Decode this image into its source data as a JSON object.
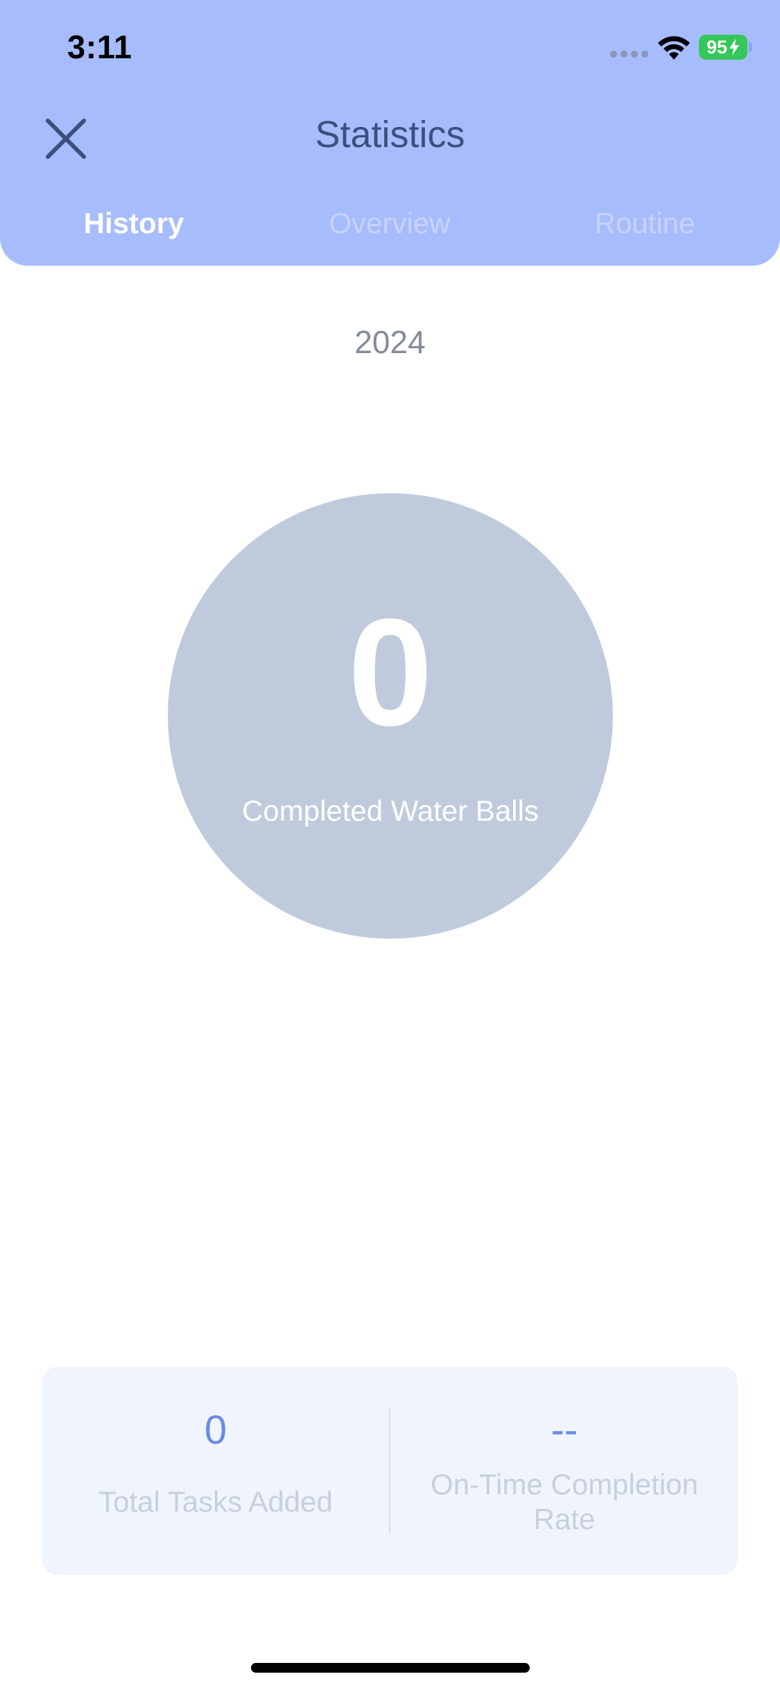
{
  "status_bar": {
    "time": "3:11",
    "battery_level": "95"
  },
  "header": {
    "title": "Statistics",
    "close_icon": "close-icon",
    "tabs": [
      {
        "label": "History",
        "active": true
      },
      {
        "label": "Overview",
        "active": false
      },
      {
        "label": "Routine",
        "active": false
      }
    ]
  },
  "main": {
    "year": "2024",
    "completed_count": "0",
    "completed_label": "Completed Water Balls"
  },
  "stats": {
    "total_tasks_value": "0",
    "total_tasks_label": "Total Tasks Added",
    "on_time_value": "--",
    "on_time_label": "On-Time Completion Rate"
  },
  "colors": {
    "header_bg": "#a7bcfd",
    "circle_bg": "#bfcbdd",
    "accent": "#6b89e6",
    "card_bg": "#eff4fe",
    "battery": "#34c759"
  }
}
